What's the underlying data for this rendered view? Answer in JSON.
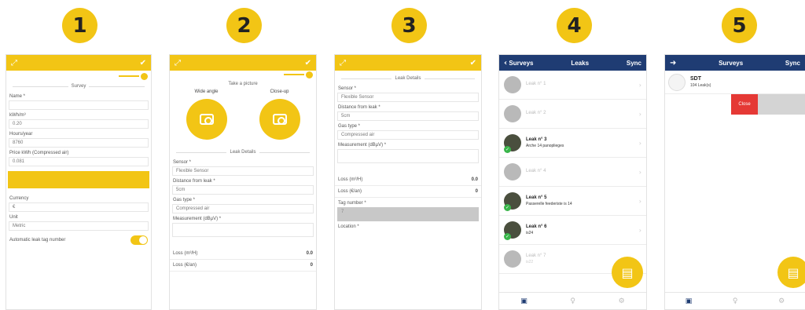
{
  "badges": [
    "1",
    "2",
    "3",
    "4",
    "5"
  ],
  "colors": {
    "accent": "#f2c515",
    "navy": "#1f3c73",
    "close": "#e53935",
    "ok": "#39b54a"
  },
  "screen1": {
    "section": "Survey",
    "fields": [
      {
        "label": "Name *",
        "value": ""
      },
      {
        "label": "kWh/m³",
        "value": "0.20"
      },
      {
        "label": "Hours/year",
        "value": "8760"
      },
      {
        "label": "Price kWh (Compressed air)",
        "value": "0.081"
      }
    ],
    "fields2": [
      {
        "label": "Currency",
        "value": "€"
      },
      {
        "label": "Unit",
        "value": "Metric"
      }
    ],
    "toggle_label": "Automatic leak tag number"
  },
  "screen2": {
    "pic_title": "Take a picture",
    "wide": "Wide angle",
    "close": "Close-up",
    "section": "Leak Details",
    "fields": [
      {
        "label": "Sensor *",
        "value": "Flexible Sensor"
      },
      {
        "label": "Distance from leak *",
        "value": "5cm"
      },
      {
        "label": "Gas type *",
        "value": "Compressed air"
      },
      {
        "label": "Measurement (dBµV) *",
        "value": ""
      }
    ],
    "loss": [
      {
        "label": "Loss (m³/H)",
        "value": "0.0"
      },
      {
        "label": "Loss (€/an)",
        "value": "0"
      }
    ]
  },
  "screen3": {
    "section": "Leak Details",
    "fields": [
      {
        "label": "Sensor *",
        "value": "Flexible Sensor"
      },
      {
        "label": "Distance from leak *",
        "value": "5cm"
      },
      {
        "label": "Gas type *",
        "value": "Compressed air"
      },
      {
        "label": "Measurement (dBµV) *",
        "value": ""
      }
    ],
    "loss": [
      {
        "label": "Loss (m³/H)",
        "value": "0.0"
      },
      {
        "label": "Loss (€/an)",
        "value": "0"
      }
    ],
    "tag_label": "Tag number *",
    "tag_value": "7",
    "location_label": "Location *"
  },
  "screen4": {
    "back": "Surveys",
    "title": "Leaks",
    "sync": "Sync",
    "leaks": [
      {
        "title": "Leak n° 1",
        "sub": ""
      },
      {
        "title": "Leak n° 2",
        "sub": ""
      },
      {
        "title": "Leak n° 3",
        "sub": "Arche 14 panoplieges"
      },
      {
        "title": "Leak n° 4",
        "sub": ""
      },
      {
        "title": "Leak n° 5",
        "sub": "Passerelle feederiste is 14"
      },
      {
        "title": "Leak n° 6",
        "sub": "is24"
      },
      {
        "title": "Leak n° 7",
        "sub": "is22"
      }
    ]
  },
  "screen5": {
    "title": "Surveys",
    "sync": "Sync",
    "survey_title": "SDT",
    "survey_sub": "104 Leak(s)",
    "close": "Close"
  }
}
